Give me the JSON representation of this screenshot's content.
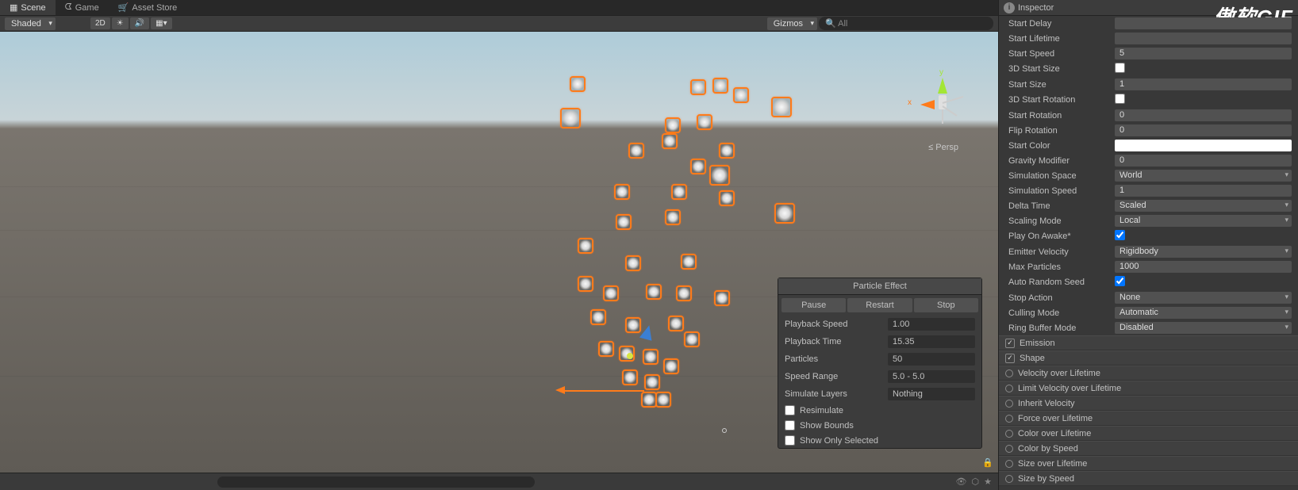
{
  "tabs": {
    "scene": "Scene",
    "game": "Game",
    "asset_store": "Asset Store"
  },
  "toolbar": {
    "shaded": "Shaded",
    "mode_2d": "2D",
    "gizmos": "Gizmos",
    "search_placeholder": "All"
  },
  "gizmo": {
    "persp": "Persp",
    "x": "x",
    "y": "y"
  },
  "particle_panel": {
    "title": "Particle Effect",
    "pause": "Pause",
    "restart": "Restart",
    "stop": "Stop",
    "playback_speed_label": "Playback Speed",
    "playback_speed": "1.00",
    "playback_time_label": "Playback Time",
    "playback_time": "15.35",
    "particles_label": "Particles",
    "particles": "50",
    "speed_range_label": "Speed Range",
    "speed_range": "5.0 - 5.0",
    "simulate_layers_label": "Simulate Layers",
    "simulate_layers": "Nothing",
    "resimulate": "Resimulate",
    "show_bounds": "Show Bounds",
    "show_only_selected": "Show Only Selected"
  },
  "inspector": {
    "title": "Inspector",
    "props": {
      "start_delay": {
        "label": "Start Delay",
        "value": ""
      },
      "start_lifetime": {
        "label": "Start Lifetime",
        "value": ""
      },
      "start_speed": {
        "label": "Start Speed",
        "value": "5"
      },
      "3d_start_size": {
        "label": "3D Start Size",
        "checked": false
      },
      "start_size": {
        "label": "Start Size",
        "value": "1"
      },
      "3d_start_rotation": {
        "label": "3D Start Rotation",
        "checked": false
      },
      "start_rotation": {
        "label": "Start Rotation",
        "value": "0"
      },
      "flip_rotation": {
        "label": "Flip Rotation",
        "value": "0"
      },
      "start_color": {
        "label": "Start Color",
        "color": "#ffffff"
      },
      "gravity_modifier": {
        "label": "Gravity Modifier",
        "value": "0"
      },
      "simulation_space": {
        "label": "Simulation Space",
        "value": "World"
      },
      "simulation_speed": {
        "label": "Simulation Speed",
        "value": "1"
      },
      "delta_time": {
        "label": "Delta Time",
        "value": "Scaled"
      },
      "scaling_mode": {
        "label": "Scaling Mode",
        "value": "Local"
      },
      "play_on_awake": {
        "label": "Play On Awake*",
        "checked": true
      },
      "emitter_velocity": {
        "label": "Emitter Velocity",
        "value": "Rigidbody"
      },
      "max_particles": {
        "label": "Max Particles",
        "value": "1000"
      },
      "auto_random_seed": {
        "label": "Auto Random Seed",
        "checked": true
      },
      "stop_action": {
        "label": "Stop Action",
        "value": "None"
      },
      "culling_mode": {
        "label": "Culling Mode",
        "value": "Automatic"
      },
      "ring_buffer_mode": {
        "label": "Ring Buffer Mode",
        "value": "Disabled"
      }
    },
    "modules": {
      "emission": {
        "label": "Emission",
        "checked": true
      },
      "shape": {
        "label": "Shape",
        "checked": true
      },
      "velocity_over_lifetime": {
        "label": "Velocity over Lifetime",
        "checked": false
      },
      "limit_velocity_over_lifetime": {
        "label": "Limit Velocity over Lifetime",
        "checked": false
      },
      "inherit_velocity": {
        "label": "Inherit Velocity",
        "checked": false
      },
      "force_over_lifetime": {
        "label": "Force over Lifetime",
        "checked": false
      },
      "color_over_lifetime": {
        "label": "Color over Lifetime",
        "checked": false
      },
      "color_by_speed": {
        "label": "Color by Speed",
        "checked": false
      },
      "size_over_lifetime": {
        "label": "Size over Lifetime",
        "checked": false
      },
      "size_by_speed": {
        "label": "Size by Speed",
        "checked": false
      }
    }
  },
  "watermark": "傲软GIF"
}
